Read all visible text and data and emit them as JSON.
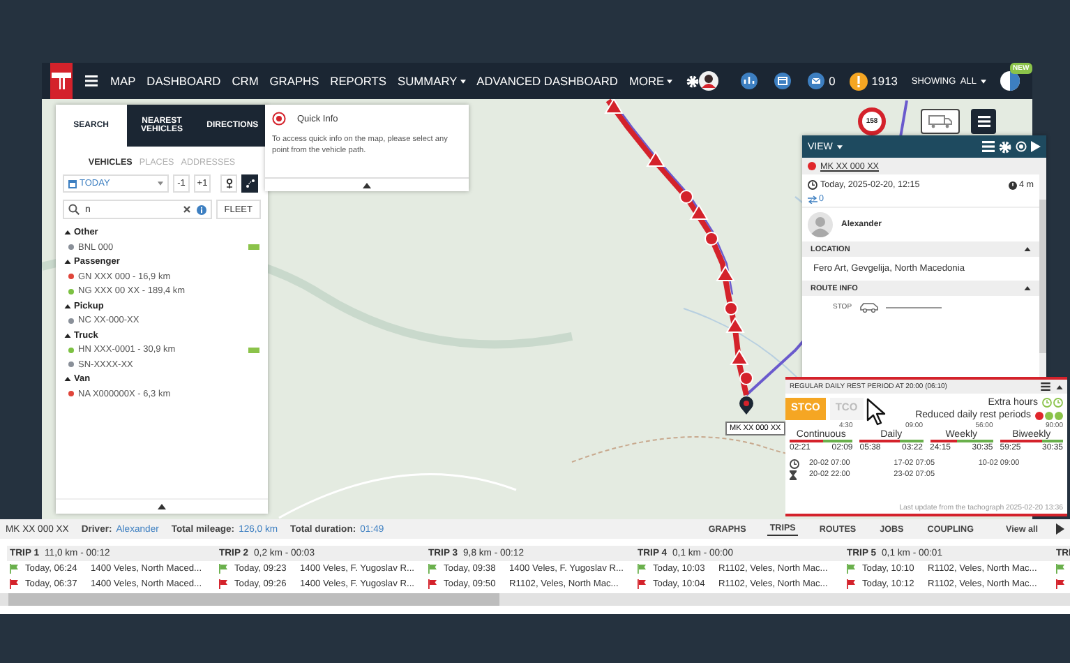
{
  "nav": {
    "items": [
      {
        "label": "MAP",
        "dropdown": false
      },
      {
        "label": "DASHBOARD",
        "dropdown": false
      },
      {
        "label": "CRM",
        "dropdown": false
      },
      {
        "label": "GRAPHS",
        "dropdown": false
      },
      {
        "label": "REPORTS",
        "dropdown": false
      },
      {
        "label": "SUMMARY",
        "dropdown": true
      },
      {
        "label": "ADVANCED DASHBOARD",
        "dropdown": false
      },
      {
        "label": "MORE",
        "dropdown": true
      }
    ],
    "message_count": "0",
    "alert_count": "1913",
    "showing": "SHOWING  ALL",
    "new_badge": "NEW"
  },
  "search_panel": {
    "tabs": [
      {
        "label": "SEARCH",
        "selected": true
      },
      {
        "label": "NEAREST VEHICLES",
        "selected": false
      },
      {
        "label": "DIRECTIONS",
        "selected": false
      }
    ],
    "subtabs": [
      {
        "label": "VEHICLES",
        "selected": true
      },
      {
        "label": "PLACES",
        "selected": false
      },
      {
        "label": "ADDRESSES",
        "selected": false
      }
    ],
    "date": "TODAY",
    "prev_day": "-1",
    "next_day": "+1",
    "search_value": "n",
    "fleet_button": "FLEET",
    "groups": [
      {
        "name": "Other",
        "expanded": true,
        "vehicles": [
          {
            "label": "BNL 000",
            "color": "#8a9099",
            "badge": true
          }
        ]
      },
      {
        "name": "Passenger",
        "expanded": true,
        "vehicles": [
          {
            "label": "GN XXX 000 - 16,9 km",
            "color": "#e0453a",
            "badge": false
          },
          {
            "label": "NG XXX 00 XX - 189,4 km",
            "color": "#7cc142",
            "badge": false
          }
        ]
      },
      {
        "name": "Pickup",
        "expanded": true,
        "vehicles": [
          {
            "label": "NC XX-000-XX",
            "color": "#8a9099",
            "badge": false
          }
        ]
      },
      {
        "name": "Truck",
        "expanded": true,
        "vehicles": [
          {
            "label": "HN XXX-0001 - 30,9 km",
            "color": "#7cc142",
            "badge": true
          },
          {
            "label": "SN-XXXX-XX",
            "color": "#8a9099",
            "badge": false
          }
        ]
      },
      {
        "name": "Van",
        "expanded": true,
        "vehicles": [
          {
            "label": "NA X000000X - 6,3 km",
            "color": "#e0453a",
            "badge": false
          }
        ]
      }
    ]
  },
  "quick_info": {
    "title": "Quick Info",
    "text": "To access quick info on the map, please select any point from the vehicle path."
  },
  "map": {
    "speed_marker": "158",
    "vehicle_label": "MK XX 000 XX"
  },
  "vehicle_panel": {
    "view": "VIEW",
    "vehicle": {
      "plate": "MK XX 000 XX",
      "color": "#e0262b"
    },
    "time": "Today, 2025-02-20, 12:15",
    "duration": "4 m",
    "count": "0",
    "driver": "Alexander",
    "sections": [
      {
        "title": "LOCATION",
        "expanded": true,
        "text": "Fero Art, Gevgelija, North Macedonia"
      },
      {
        "title": "ROUTE INFO",
        "expanded": true,
        "text": "STOP"
      }
    ]
  },
  "tacho": {
    "title": "REGULAR DAILY REST PERIOD AT 20:00 (06:10)",
    "tabs": [
      {
        "label": "STCO",
        "selected": true
      },
      {
        "label": "TCO",
        "selected": false
      }
    ],
    "extra_hours": {
      "label": "Extra hours",
      "icons": [
        {
          "color": "#8bc34a"
        },
        {
          "color": "#8bc34a"
        }
      ]
    },
    "reduced_rest": {
      "label": "Reduced daily rest periods",
      "dots": [
        {
          "color": "#e0262b"
        },
        {
          "color": "#8bc34a"
        },
        {
          "color": "#8bc34a"
        }
      ]
    },
    "columns": [
      {
        "name": "Continuous",
        "limit": "4:30",
        "used": "02:21",
        "left": "02:09",
        "level": 0.52
      },
      {
        "name": "Daily",
        "limit": "09:00",
        "used": "05:38",
        "left": "03:22",
        "level": 0.63
      },
      {
        "name": "Weekly",
        "limit": "56:00",
        "used": "24:15",
        "left": "30:35",
        "level": 0.43
      },
      {
        "name": "Biweekly",
        "limit": "90:00",
        "used": "59:25",
        "left": "30:35",
        "level": 0.66
      }
    ],
    "times": [
      {
        "kind": "start",
        "values": [
          "20-02 07:00",
          "17-02 07:05",
          "10-02 09:00"
        ]
      },
      {
        "kind": "end",
        "values": [
          "20-02 22:00",
          "23-02 07:05"
        ]
      }
    ],
    "footer": "Last update from the tachograph 2025-02-20 13:36"
  },
  "bottom": {
    "plate": "MK XX 000 XX",
    "info": [
      {
        "label": "Driver:",
        "value": "Alexander"
      },
      {
        "label": "Total mileage:",
        "value": "126,0 km"
      },
      {
        "label": "Total duration:",
        "value": "01:49"
      }
    ],
    "tabs": [
      {
        "label": "GRAPHS",
        "selected": false
      },
      {
        "label": "TRIPS",
        "selected": true
      },
      {
        "label": "ROUTES",
        "selected": false
      },
      {
        "label": "JOBS",
        "selected": false
      },
      {
        "label": "COUPLING",
        "selected": false
      }
    ],
    "view_all": "View all",
    "trips": [
      {
        "title": "TRIP 1",
        "summary": "11,0 km - 00:12",
        "rows": [
          {
            "kind": "start",
            "time": "Today, 06:24",
            "place": "1400 Veles, North Maced..."
          },
          {
            "kind": "end",
            "time": "Today, 06:37",
            "place": "1400 Veles, North Maced..."
          }
        ]
      },
      {
        "title": "TRIP 2",
        "summary": "0,2 km - 00:03",
        "rows": [
          {
            "kind": "start",
            "time": "Today, 09:23",
            "place": "1400 Veles, F. Yugoslav R..."
          },
          {
            "kind": "end",
            "time": "Today, 09:26",
            "place": "1400 Veles, F. Yugoslav R..."
          }
        ]
      },
      {
        "title": "TRIP 3",
        "summary": "9,8 km - 00:12",
        "rows": [
          {
            "kind": "start",
            "time": "Today, 09:38",
            "place": "1400 Veles, F. Yugoslav R..."
          },
          {
            "kind": "end",
            "time": "Today, 09:50",
            "place": "R1102, Veles, North Mac..."
          }
        ]
      },
      {
        "title": "TRIP 4",
        "summary": "0,1 km - 00:00",
        "rows": [
          {
            "kind": "start",
            "time": "Today, 10:03",
            "place": "R1102, Veles, North Mac..."
          },
          {
            "kind": "end",
            "time": "Today, 10:04",
            "place": "R1102, Veles, North Mac..."
          }
        ]
      },
      {
        "title": "TRIP 5",
        "summary": "0,1 km - 00:01",
        "rows": [
          {
            "kind": "start",
            "time": "Today, 10:10",
            "place": "R1102, Veles, North Mac..."
          },
          {
            "kind": "end",
            "time": "Today, 10:12",
            "place": "R1102, Veles, North Mac..."
          }
        ]
      },
      {
        "title": "TRI",
        "rows": [
          {
            "kind": "start"
          },
          {
            "kind": "end"
          }
        ]
      }
    ]
  }
}
